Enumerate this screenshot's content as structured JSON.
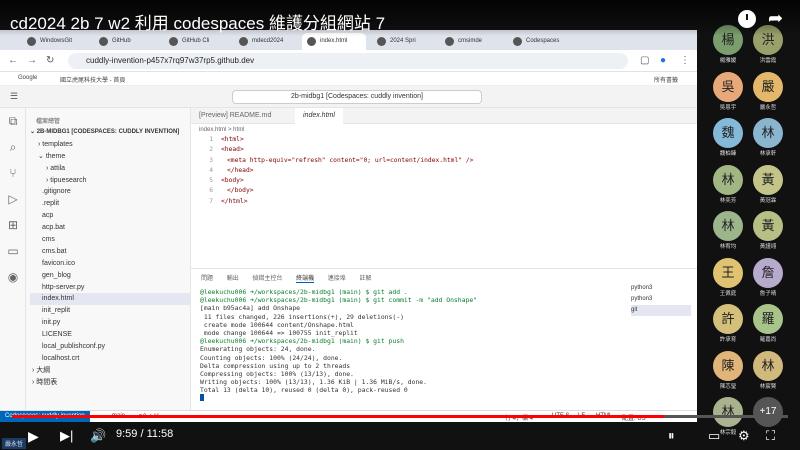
{
  "video": {
    "title": "cd2024 2b 7 w2 利用 codespaces 維護分組網站 7",
    "time": "9:59 / 11:58",
    "progress": 0.84
  },
  "browser": {
    "tabs": [
      "WindowsGit",
      "GitHub",
      "GitHub Cli",
      "mdecd2024",
      "index.html",
      "2024 Spri",
      "cmsimde",
      "Codespaces"
    ],
    "url": "cuddly-invention-p457x7rq97w37rp5.github.dev",
    "bookmarks": [
      "Google",
      "國立虎尾科技大學 - 首頁"
    ],
    "all_bookmarks": "所有書籤"
  },
  "vscode": {
    "command_center": "2b-midbg1 [Codespaces: cuddly invention]",
    "explorer_title": "檔案總管",
    "root": "2B-MIDBG1 [CODESPACES: CUDDLY INVENTION]",
    "tree": [
      "templates",
      "theme",
      "attila",
      "tipuesearch",
      ".gitignore",
      ".replit",
      "acp",
      "acp.bat",
      "cms",
      "cms.bat",
      "favicon.ico",
      "gen_blog",
      "http-server.py",
      "index.html",
      "init_replit",
      "init.py",
      "LICENSE",
      "local_publishconf.py",
      "localhost.crt",
      "大綱",
      "時間表"
    ],
    "editor_tabs": [
      "[Preview] README.md",
      "index.html"
    ],
    "breadcrumb": "index.html > html",
    "code": [
      "<html>",
      "<head>",
      "<meta http-equiv=\"refresh\" content=\"0; url=content/index.html\" />",
      "</head>",
      "<body>",
      "</body>",
      "</html>"
    ],
    "panel_tabs": [
      "問題",
      "輸出",
      "偵錯主控台",
      "終端機",
      "連接埠",
      "註解"
    ],
    "terminal": [
      "@leekuchu006 ➜/workspaces/2b-midbg1 (main) $ git add .",
      "@leekuchu006 ➜/workspaces/2b-midbg1 (main) $ git commit -m \"add Onshape\"",
      "[main b95ac4a] add Onshape",
      " 11 files changed, 226 insertions(+), 29 deletions(-)",
      " create mode 100644 content/Onshape.html",
      " mode change 100644 => 100755 init_replit",
      "@leekuchu006 ➜/workspaces/2b-midbg1 (main) $ git push",
      "Enumerating objects: 24, done.",
      "Counting objects: 100% (24/24), done.",
      "Delta compression using up to 2 threads",
      "Compressing objects: 100% (13/13), done.",
      "Writing objects: 100% (13/13), 1.36 KiB | 1.36 MiB/s, done.",
      "Total 13 (delta 10), reused 0 (delta 0), pack-reused 0"
    ],
    "term_list": [
      "python3",
      "python3",
      "git"
    ],
    "status": {
      "remote": "Codespaces: cuddly invention",
      "branch": "main",
      "errors": "⊗0 ⚠11",
      "position": "行 4，欄 4",
      "encoding": "UTF-8",
      "eol": "LF",
      "lang": "HTML",
      "layout": "配置: US"
    }
  },
  "participants": [
    {
      "init": "楊",
      "name": "楊雅媛",
      "color": "#7b9e6f"
    },
    {
      "init": "洪",
      "name": "洪雲霞",
      "color": "#9aa06a"
    },
    {
      "init": "吳",
      "name": "吳恩宇",
      "color": "#e9a87a"
    },
    {
      "init": "嚴",
      "name": "嚴永哲",
      "color": "#e3b86a"
    },
    {
      "init": "魏",
      "name": "魏柏臻",
      "color": "#84b9d8"
    },
    {
      "init": "林",
      "name": "林承軒",
      "color": "#8ab5cf"
    },
    {
      "init": "林",
      "name": "林奕芳",
      "color": "#a1b682"
    },
    {
      "init": "黃",
      "name": "黃冠霖",
      "color": "#c4c38a"
    },
    {
      "init": "林",
      "name": "林宥均",
      "color": "#9db58a"
    },
    {
      "init": "黃",
      "name": "黃謹翊",
      "color": "#b7bf85"
    },
    {
      "init": "王",
      "name": "王佩庭",
      "color": "#e0c273"
    },
    {
      "init": "詹",
      "name": "詹子晴",
      "color": "#b6aacd"
    },
    {
      "init": "許",
      "name": "許承育",
      "color": "#d4c07a"
    },
    {
      "init": "羅",
      "name": "羅嘉尚",
      "color": "#a8c48a"
    },
    {
      "init": "陳",
      "name": "陳芯瑩",
      "color": "#e1b47a"
    },
    {
      "init": "林",
      "name": "林宸賢",
      "color": "#d1b87c"
    },
    {
      "init": "林",
      "name": "林宗毅",
      "color": "#a9b28f"
    },
    {
      "init": "+17",
      "name": "",
      "color": "#555"
    }
  ],
  "presenter_label": "嚴永哲"
}
